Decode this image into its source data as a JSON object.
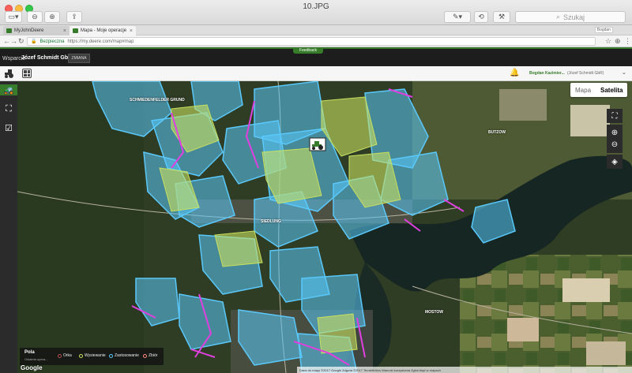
{
  "viewer": {
    "title": "10.JPG",
    "search_placeholder": "Szukaj"
  },
  "browser": {
    "tabs": [
      {
        "label": "MyJohnDeere",
        "active": false
      },
      {
        "label": "Mapa - Moje operacje",
        "active": true
      }
    ],
    "profile": "Bogdan",
    "url_secure": "Bezpieczna",
    "url": "https://my.deere.com/map#map"
  },
  "app": {
    "feedback": "Feedback",
    "support": "Wsparcie",
    "org_name": "Józef Schmidt GbR",
    "change_label": "ZMIANA",
    "user_name": "Bogdan Kazimier...",
    "user_org": "(Józef Schmidt GbR)"
  },
  "sidebar": {
    "items": [
      {
        "icon": "tractor-icon",
        "glyph": "🚜"
      },
      {
        "icon": "boundary-icon",
        "glyph": "⛶"
      },
      {
        "icon": "checklist-icon",
        "glyph": "☑"
      }
    ]
  },
  "map": {
    "type_options": [
      "Mapa",
      "Satelita"
    ],
    "selected_type": "Satelita",
    "places": [
      {
        "id": "p1",
        "label": "SCHMIEDENFELDER GRUND"
      },
      {
        "id": "p2",
        "label": "SIEDLUNG"
      },
      {
        "id": "p3",
        "label": "BUTZOW"
      },
      {
        "id": "p4",
        "label": "MOSTOW"
      }
    ],
    "controls": [
      "fullscreen-icon",
      "zoom-in-icon",
      "zoom-out-icon",
      "layers-icon"
    ],
    "google_logo": "Google",
    "attribution": "Dane do mapy ©2017 Google  Zdjęcia ©2017 TerraMetrics  Warunki korzystania  Zgłoś błąd w mapach"
  },
  "legend": {
    "title": "Pola",
    "subtitle": "Ostatnia opera...",
    "items": [
      {
        "label": "Orka",
        "color": "#b05050"
      },
      {
        "label": "Wysiewanie",
        "color": "#c8e060"
      },
      {
        "label": "Zastosowanie",
        "color": "#5ac8fa"
      },
      {
        "label": "Zbiór",
        "color": "#ff8a80"
      }
    ]
  },
  "colors": {
    "brand_green": "#367c2b",
    "field_blue": "#5ac8fa",
    "field_green": "#c8e060",
    "field_magenta": "#e040e0"
  }
}
